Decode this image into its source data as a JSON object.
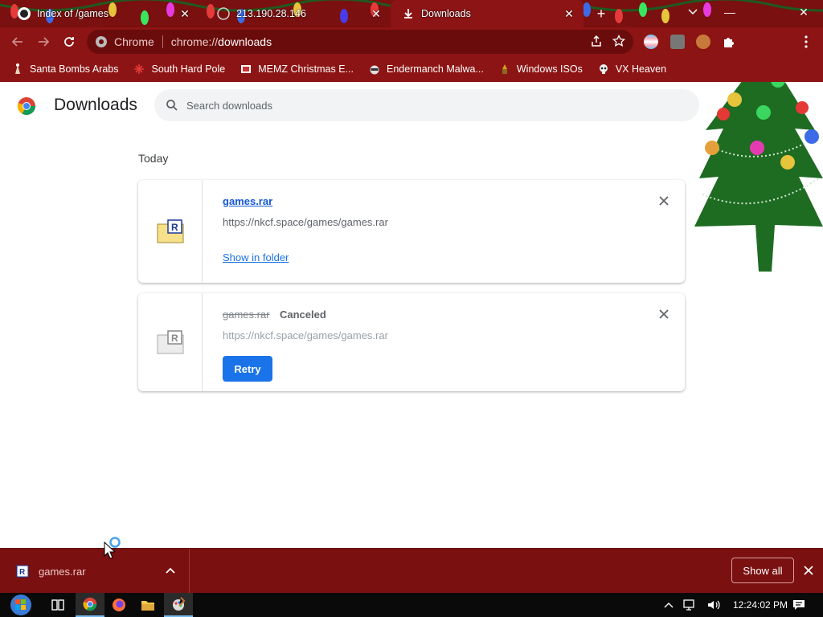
{
  "tabs": [
    {
      "title": "Index of /games",
      "icon": "github-icon"
    },
    {
      "title": "213.190.28.146",
      "icon": "globe-icon"
    },
    {
      "title": "Downloads",
      "icon": "download-icon",
      "active": true
    }
  ],
  "toolbar": {
    "omnibox_chip": "Chrome",
    "url_scheme": "chrome://",
    "url_path": "downloads"
  },
  "bookmarks": [
    {
      "label": "Santa Bombs Arabs",
      "icon": "santa-icon"
    },
    {
      "label": "South Hard Pole",
      "icon": "snowflake-icon"
    },
    {
      "label": "MEMZ Christmas E...",
      "icon": "memz-icon"
    },
    {
      "label": "Endermanch Malwa...",
      "icon": "raccoon-icon"
    },
    {
      "label": "Windows ISOs",
      "icon": "gnome-icon"
    },
    {
      "label": "VX Heaven",
      "icon": "skull-icon"
    }
  ],
  "page": {
    "title": "Downloads",
    "search_placeholder": "Search downloads",
    "section_label": "Today"
  },
  "downloads": [
    {
      "filename": "games.rar",
      "url": "https://nkcf.space/games/games.rar",
      "action": "Show in folder",
      "status": ""
    },
    {
      "filename": "games.rar",
      "url": "https://nkcf.space/games/games.rar",
      "action": "Retry",
      "status": "Canceled"
    }
  ],
  "shelf": {
    "item_name": "games.rar",
    "show_all": "Show all"
  },
  "taskbar": {
    "clock": "12:24:02 PM"
  },
  "colors": {
    "theme_red": "#8c1414",
    "accent_blue": "#1a73e8"
  }
}
